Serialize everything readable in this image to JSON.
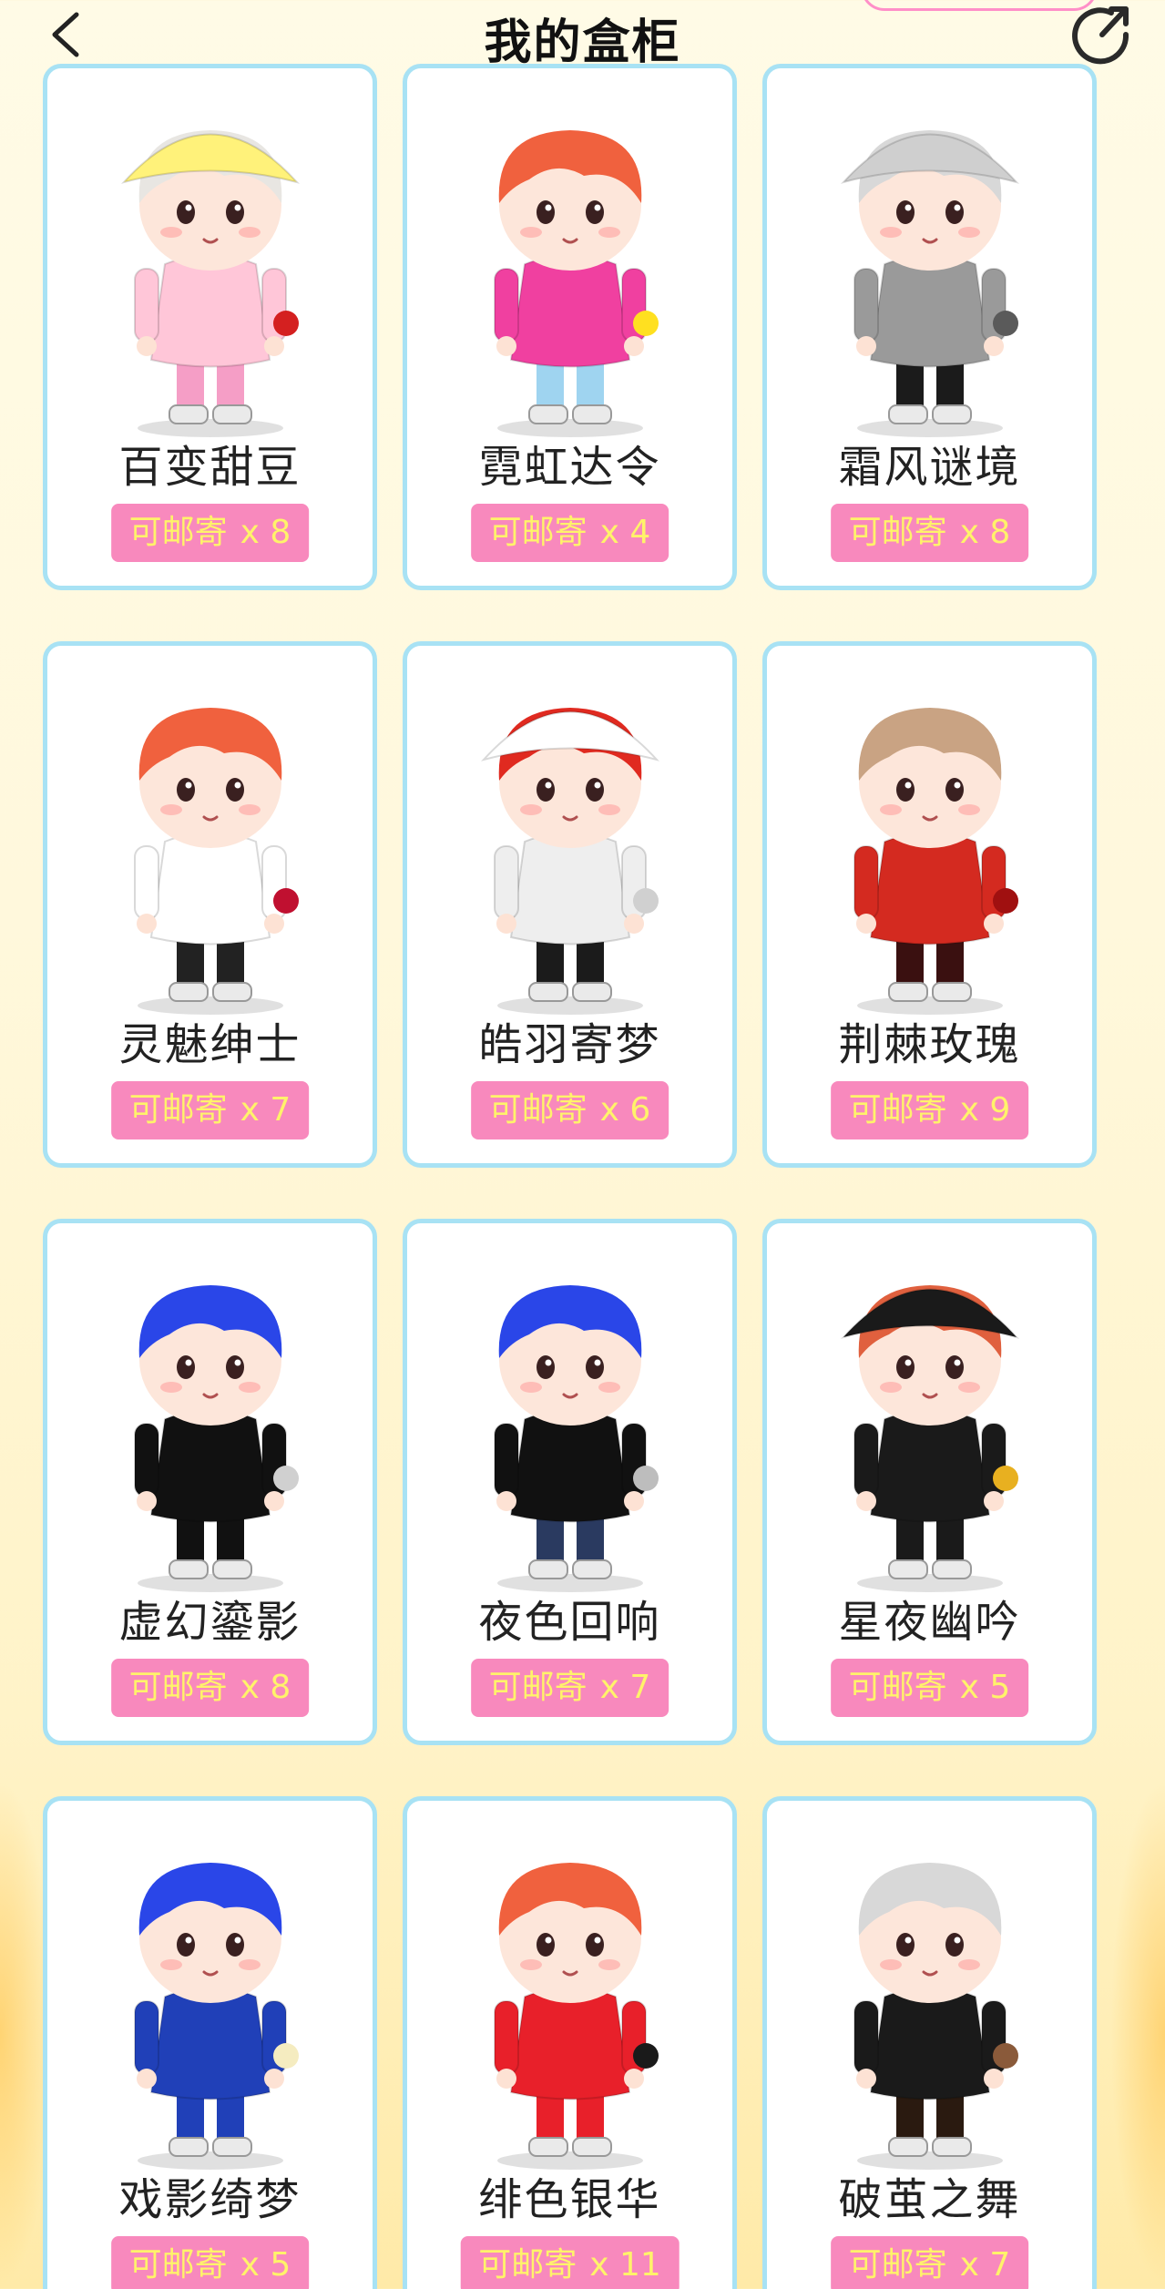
{
  "header": {
    "title": "我的盒柜",
    "back_icon": "chevron-left-icon",
    "share_icon": "share-arrow-icon"
  },
  "colors": {
    "card_border": "#a8e2f4",
    "badge_bg": "#f889bd",
    "badge_text": "#fff36a",
    "page_bg": "#fff8dc"
  },
  "badge_label": "可邮寄",
  "items": [
    {
      "name": "百变甜豆",
      "count": "x 8",
      "hair": "#e8e6e2",
      "hat": "#fff27a",
      "outfit": "#ffc6d8",
      "pants": "#f59ec6",
      "accent": "#d42020"
    },
    {
      "name": "霓虹达令",
      "count": "x 4",
      "hair": "#f0613e",
      "hat": "",
      "outfit": "#f040a0",
      "pants": "#9fd4f0",
      "accent": "#ffe020"
    },
    {
      "name": "霜风谜境",
      "count": "x 8",
      "hair": "#d8d8d8",
      "hat": "#cfcfcf",
      "outfit": "#9a9a9a",
      "pants": "#1b1b1b",
      "accent": "#5a5a5a"
    },
    {
      "name": "灵魅绅士",
      "count": "x 7",
      "hair": "#f0613e",
      "hat": "",
      "outfit": "#ffffff",
      "pants": "#222222",
      "accent": "#c01030"
    },
    {
      "name": "皓羽寄梦",
      "count": "x 6",
      "hair": "#e02a20",
      "hat": "#ffffff",
      "outfit": "#eeeeee",
      "pants": "#1b1b1b",
      "accent": "#d0d0d0"
    },
    {
      "name": "荆棘玫瑰",
      "count": "x 9",
      "hair": "#c9a383",
      "hat": "",
      "outfit": "#d42a20",
      "pants": "#3a1010",
      "accent": "#a01010"
    },
    {
      "name": "虚幻鎏影",
      "count": "x 8",
      "hair": "#2a46e8",
      "hat": "",
      "outfit": "#111111",
      "pants": "#111111",
      "accent": "#d0d0d0"
    },
    {
      "name": "夜色回响",
      "count": "x 7",
      "hair": "#2a46e8",
      "hat": "",
      "outfit": "#111111",
      "pants": "#2a3a60",
      "accent": "#bdbdbd"
    },
    {
      "name": "星夜幽吟",
      "count": "x 5",
      "hair": "#e0603e",
      "hat": "#1a1a1a",
      "outfit": "#1a1a1a",
      "pants": "#1a1a1a",
      "accent": "#e8b020"
    },
    {
      "name": "戏影绮梦",
      "count": "x 5",
      "hair": "#2a46e8",
      "hat": "",
      "outfit": "#2040b8",
      "pants": "#2040b8",
      "accent": "#f5ecc0"
    },
    {
      "name": "绯色银华",
      "count": "x 11",
      "hair": "#f0613e",
      "hat": "",
      "outfit": "#e8202a",
      "pants": "#e8202a",
      "accent": "#1a1a1a"
    },
    {
      "name": "破茧之舞",
      "count": "x 7",
      "hair": "#d8d8d8",
      "hat": "",
      "outfit": "#1a1a1a",
      "pants": "#2a1a10",
      "accent": "#8a5a3a"
    }
  ]
}
